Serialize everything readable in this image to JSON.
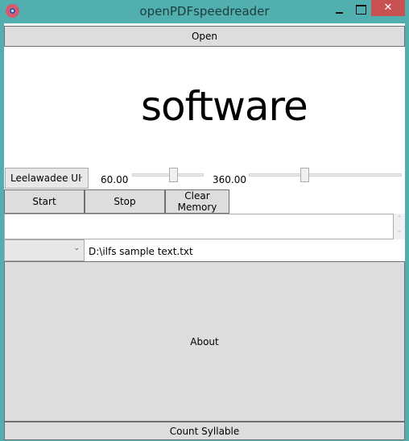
{
  "window": {
    "title": "openPDFspeedreader",
    "close_label": "✕"
  },
  "open_button": "Open",
  "current_word": "software",
  "font_select": {
    "value": "Leelawadee UI"
  },
  "slider1": {
    "label": "60.00",
    "fraction": 0.58
  },
  "slider2": {
    "label": "360.00",
    "fraction": 0.35
  },
  "buttons": {
    "start": "Start",
    "stop": "Stop",
    "clear": "Clear Memory",
    "about": "About",
    "count": "Count Syllable"
  },
  "textbox": {
    "value": ""
  },
  "file_select": {
    "value": ""
  },
  "file_path": "D:\\ilfs sample text.txt"
}
